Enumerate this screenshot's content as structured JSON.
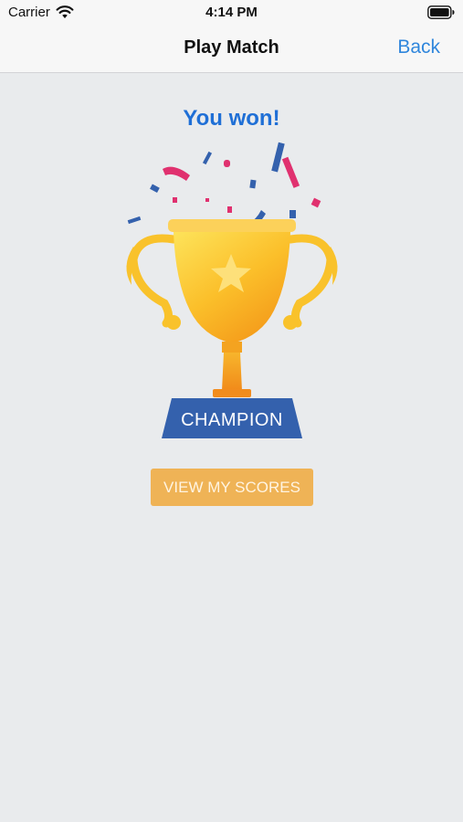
{
  "status_bar": {
    "carrier": "Carrier",
    "time": "4:14 PM"
  },
  "nav_bar": {
    "title": "Play Match",
    "back_label": "Back"
  },
  "main": {
    "result_title": "You won!",
    "trophy_label": "CHAMPION",
    "view_scores_label": "VIEW MY SCORES"
  },
  "colors": {
    "accent_blue": "#2f86dc",
    "title_blue": "#1f6fd6",
    "button_orange": "#efb356",
    "pedestal_blue": "#3461ad",
    "confetti_pink": "#e0316f"
  },
  "icons": [
    "wifi-icon",
    "battery-icon",
    "trophy-icon",
    "star-icon",
    "confetti"
  ]
}
